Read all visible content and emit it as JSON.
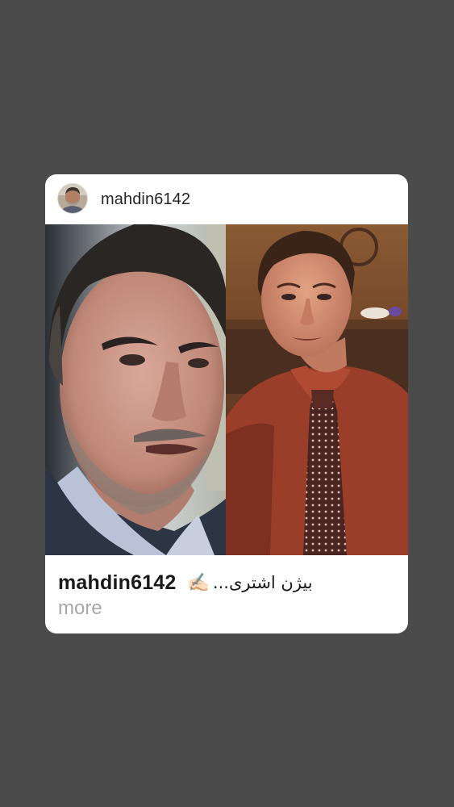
{
  "post": {
    "header": {
      "username": "mahdin6142",
      "avatar_icon": "profile-avatar"
    },
    "media": {
      "left_image": "portrait-man-suit",
      "right_image": "portrait-man-red-shirt-tie"
    },
    "caption": {
      "username": "mahdin6142",
      "emoji": "✍🏻",
      "text": "...بیژن اشتری",
      "more_label": "more"
    }
  },
  "colors": {
    "background": "#4b4b4b",
    "card": "#ffffff",
    "text": "#262626",
    "muted": "#a8a8a8"
  }
}
